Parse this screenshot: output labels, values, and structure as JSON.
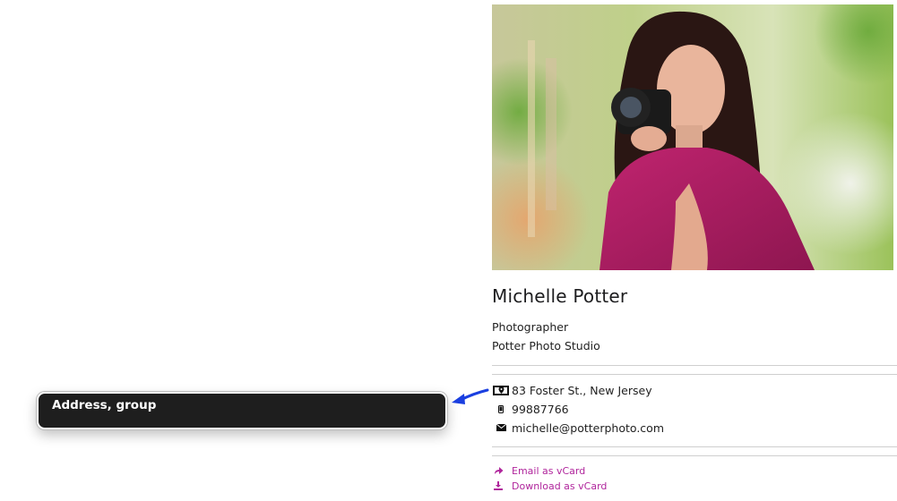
{
  "card": {
    "name": "Michelle Potter",
    "role": "Photographer",
    "company": "Potter Photo Studio",
    "address": "83 Foster St., New Jersey",
    "phone": "99887766",
    "email": "michelle@potterphoto.com",
    "email_vcard": "Email as vCard",
    "download_vcard": "Download as vCard"
  },
  "icons": {
    "address": "map-marker-icon",
    "phone": "mobile-phone-icon",
    "email": "envelope-icon",
    "share": "share-arrow-icon",
    "download": "download-icon"
  },
  "tooltip": {
    "text": "Address, group"
  },
  "colors": {
    "link": "#b0259c",
    "tooltip_bg": "#1e1e1e",
    "arrow": "#1a3fe0"
  }
}
